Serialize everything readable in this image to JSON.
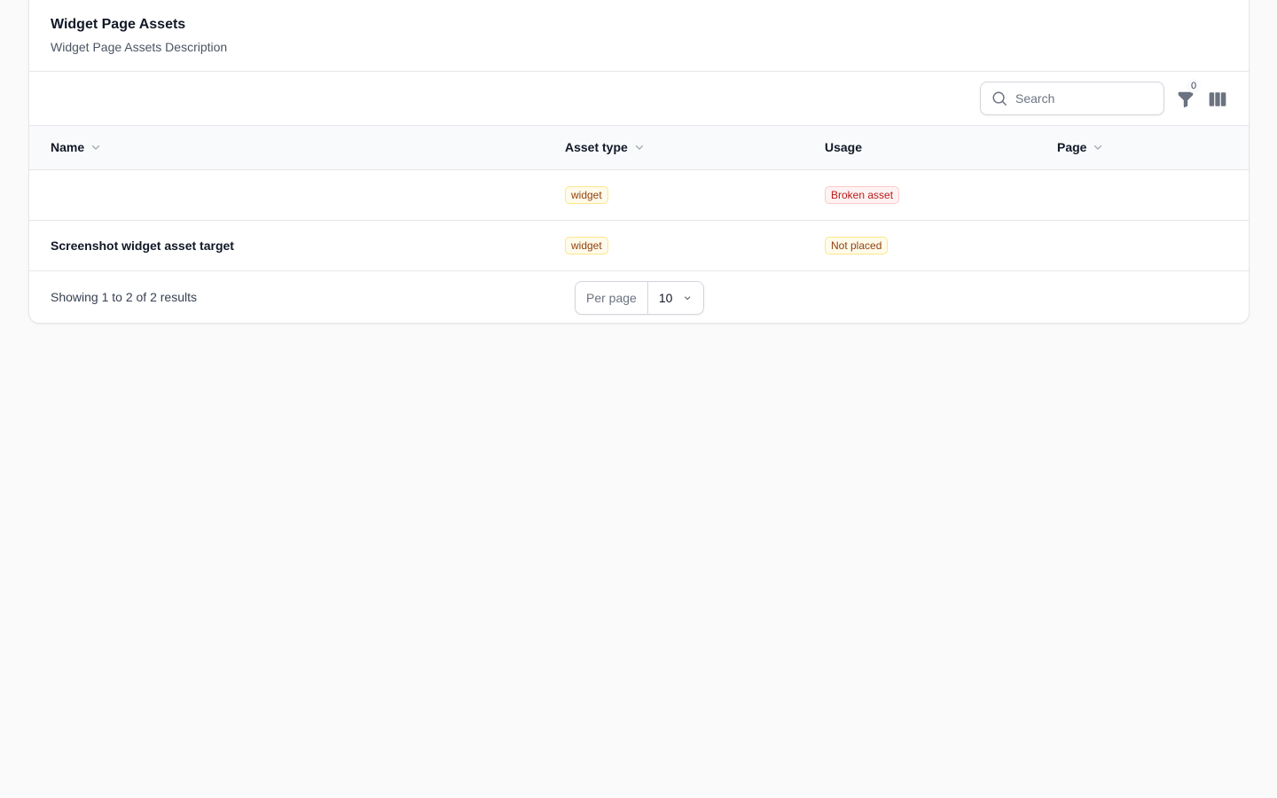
{
  "header": {
    "title": "Widget Page Assets",
    "description": "Widget Page Assets Description"
  },
  "toolbar": {
    "search_placeholder": "Search",
    "filter_count": "0",
    "icons": [
      "search-icon",
      "filter-icon",
      "columns-icon"
    ]
  },
  "table": {
    "columns": [
      {
        "label": "Name",
        "sortable": true
      },
      {
        "label": "Asset type",
        "sortable": true
      },
      {
        "label": "Usage",
        "sortable": false
      },
      {
        "label": "Page",
        "sortable": true
      }
    ],
    "rows": [
      {
        "name": "",
        "asset_type": "widget",
        "usage": "Broken asset",
        "usage_status": "danger",
        "page": ""
      },
      {
        "name": "Screenshot widget asset target",
        "asset_type": "widget",
        "usage": "Not placed",
        "usage_status": "warning",
        "page": ""
      }
    ]
  },
  "pagination": {
    "results_text": "Showing 1 to 2 of 2 results",
    "per_page_label": "Per page",
    "per_page_value": "10"
  },
  "colors": {
    "background": "#fafafb",
    "card": "#ffffff",
    "border": "#e5e7eb",
    "warning_text": "#92400e",
    "warning_bg": "#fffbeb",
    "danger_text": "#b91c1c",
    "danger_bg": "#fef2f2"
  }
}
